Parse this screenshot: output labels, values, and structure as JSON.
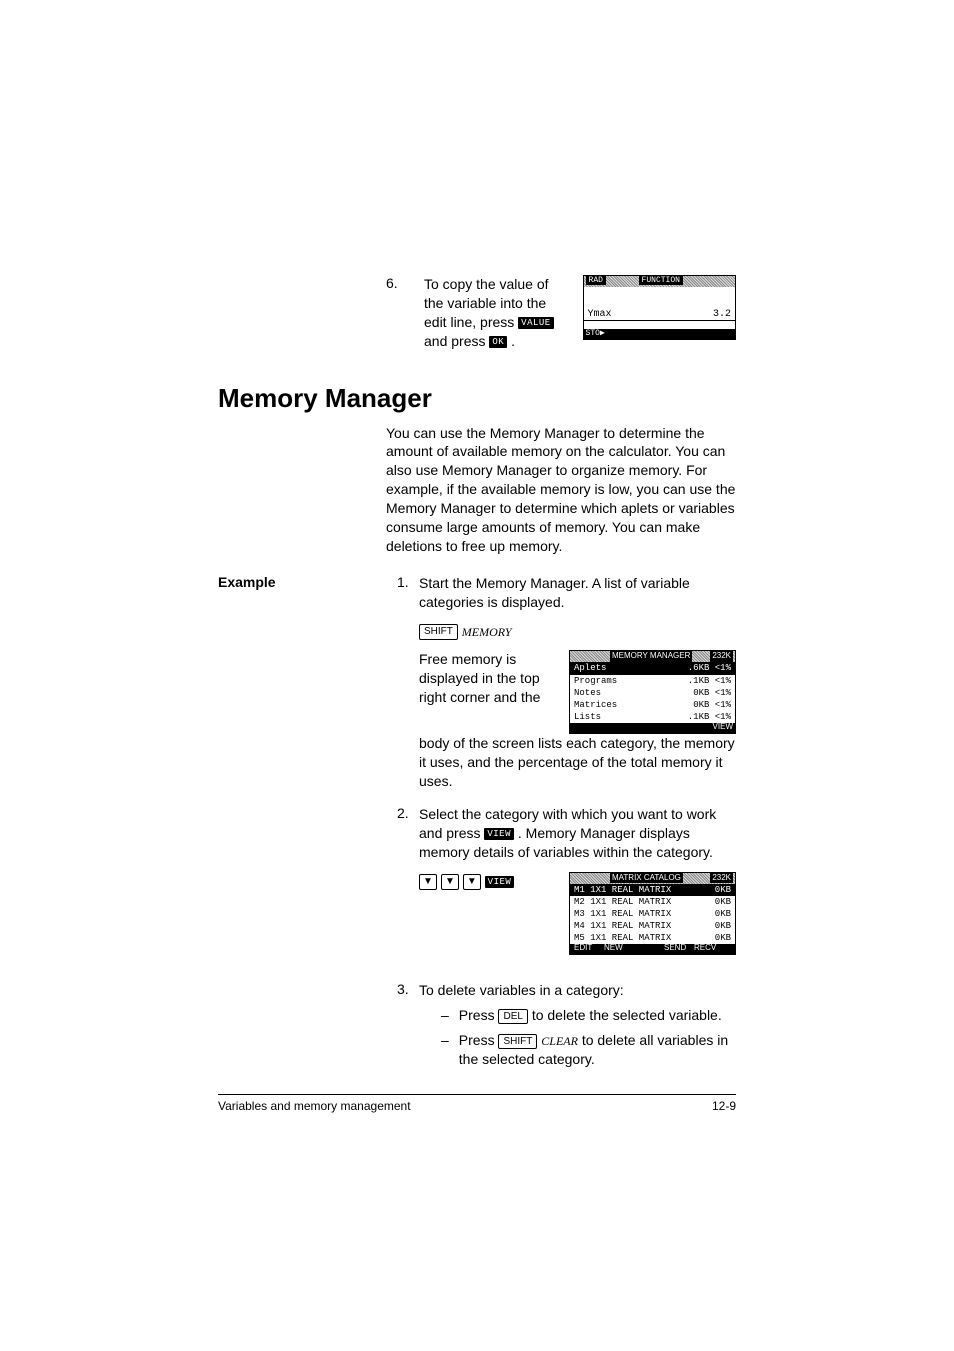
{
  "step6": {
    "num": "6.",
    "text_before": "To copy the value of the variable into the edit line, press ",
    "key1": "VALUE",
    "mid": " and press ",
    "key2": "OK",
    "end": " ."
  },
  "screenshot1": {
    "badge_left": "RAD",
    "badge_center": "FUNCTION",
    "line_label": "Ymax",
    "line_value": "3.2",
    "foot_left": "STO▶"
  },
  "section_title": "Memory Manager",
  "intro_para": "You can use the Memory Manager to determine the amount of available memory on the calculator. You can also use Memory Manager to organize memory. For example, if the available memory is low, you can use the Memory Manager to determine which aplets or variables consume large amounts of memory. You can make deletions to free up memory.",
  "example_label": "Example",
  "step1": {
    "num": "1.",
    "text": "Start the Memory Manager. A list of variable categories is displayed.",
    "keys": {
      "shift": "SHIFT",
      "memory": "MEMORY"
    },
    "desc1": "Free memory is displayed in the top right corner and the body of the screen lists each category, the memory it uses, and the percentage of the total memory it uses."
  },
  "mm1": {
    "title_center": "MEMORY MANAGER",
    "title_right": "232K",
    "rows": [
      {
        "name": "Aplets",
        "size": ".6KB",
        "pct": "<1%",
        "hl": true
      },
      {
        "name": "Programs",
        "size": ".1KB",
        "pct": "<1%",
        "hl": false
      },
      {
        "name": "Notes",
        "size": "0KB",
        "pct": "<1%",
        "hl": false
      },
      {
        "name": "Matrices",
        "size": "0KB",
        "pct": "<1%",
        "hl": false
      },
      {
        "name": "Lists",
        "size": ".1KB",
        "pct": "<1%",
        "hl": false
      }
    ],
    "foot_right": "VIEW"
  },
  "step2": {
    "num": "2.",
    "before": "Select the category with which you want to work and press ",
    "key": "VIEW",
    "after": " . Memory Manager displays memory details of variables within the category.",
    "arrows": "▼",
    "view_key": "VIEW"
  },
  "mm2": {
    "title_center": "MATRIX CATALOG",
    "title_right": "232K",
    "rows": [
      {
        "n": "M1",
        "t": "1X1 REAL MATRIX",
        "s": "0KB",
        "hl": true
      },
      {
        "n": "M2",
        "t": "1X1 REAL MATRIX",
        "s": "0KB",
        "hl": false
      },
      {
        "n": "M3",
        "t": "1X1 REAL MATRIX",
        "s": "0KB",
        "hl": false
      },
      {
        "n": "M4",
        "t": "1X1 REAL MATRIX",
        "s": "0KB",
        "hl": false
      },
      {
        "n": "M5",
        "t": "1X1 REAL MATRIX",
        "s": "0KB",
        "hl": false
      }
    ],
    "foot": {
      "l1": "EDIT",
      "l2": "NEW",
      "l3": "SEND",
      "l4": "RECV"
    }
  },
  "step3": {
    "num": "3.",
    "text": "To delete variables in a category:",
    "sub1_before": "Press ",
    "sub1_key": "DEL",
    "sub1_after": " to delete the selected variable.",
    "sub2_before": "Press ",
    "sub2_key1": "SHIFT",
    "sub2_key2": "CLEAR",
    "sub2_after": " to delete all variables in the selected category.",
    "dash": "–"
  },
  "footer": {
    "left": "Variables and memory management",
    "right": "12-9"
  }
}
